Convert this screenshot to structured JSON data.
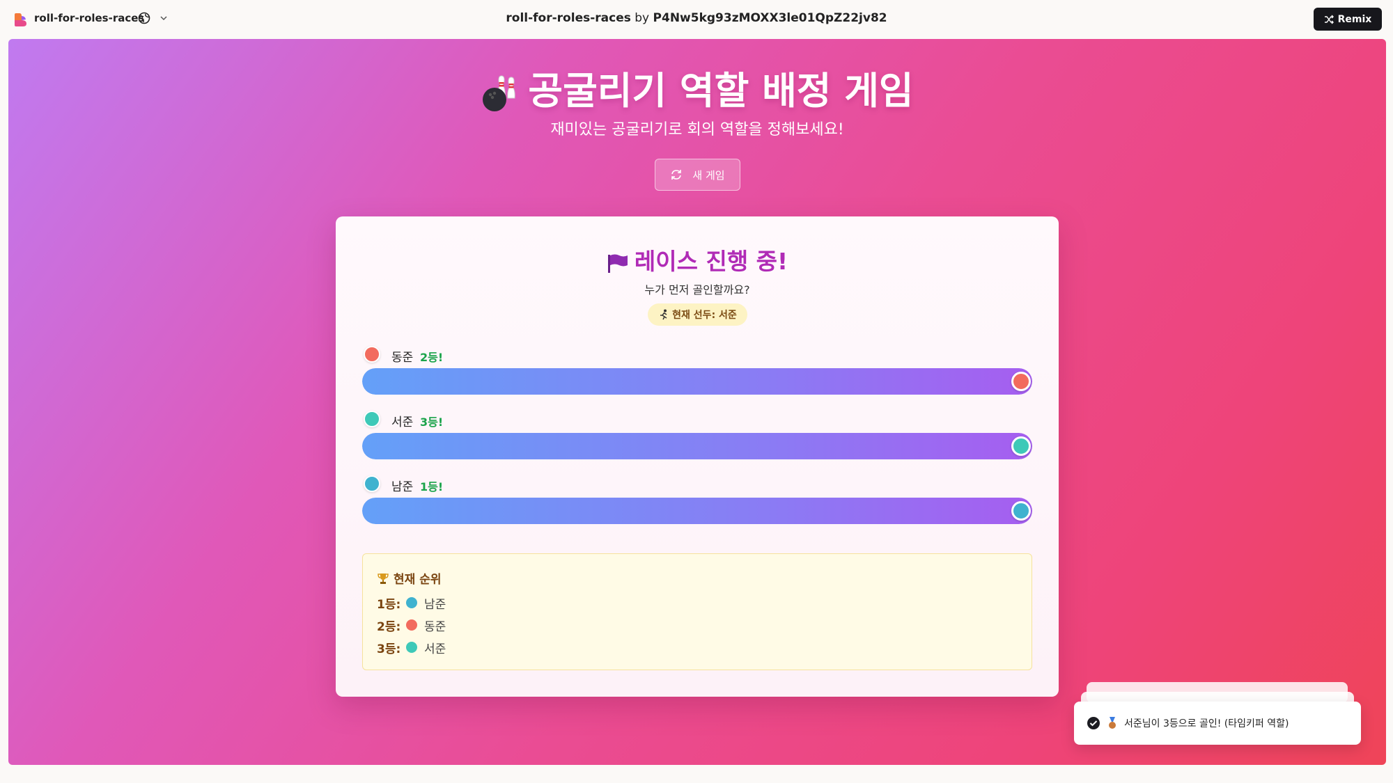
{
  "topbar": {
    "app_name": "roll-for-roles-races",
    "title_app": "roll-for-roles-races",
    "title_by": "by",
    "title_user": "P4Nw5kg93zMOXX3le01QpZ22jv82",
    "remix_label": "Remix"
  },
  "header": {
    "title": "공굴리기 역할 배정 게임",
    "subtitle": "재미있는 공굴리기로 회의 역할을 정해보세요!",
    "new_game_label": "새 게임"
  },
  "race": {
    "title": "레이스 진행 중!",
    "subtitle": "누가 먼저 골인할까요?",
    "leader_label": "현재 선두: 서준",
    "racers": [
      {
        "name": "동준",
        "rank": "2등!",
        "color": "#f26b5e",
        "progress": 1.0
      },
      {
        "name": "서준",
        "rank": "3등!",
        "color": "#3ec9b8",
        "progress": 1.0
      },
      {
        "name": "남준",
        "rank": "1등!",
        "color": "#3fb2cf",
        "progress": 1.0
      }
    ]
  },
  "ranking": {
    "title": "현재 순위",
    "rows": [
      {
        "label": "1등:",
        "name": "남준",
        "color": "#3fb2cf"
      },
      {
        "label": "2등:",
        "name": "동준",
        "color": "#f26b5e"
      },
      {
        "label": "3등:",
        "name": "서준",
        "color": "#3ec9b8"
      }
    ]
  },
  "toast": {
    "message": "서준님이 3등으로 골인! (타임키퍼 역할)"
  },
  "colors": {
    "accent": "#b02bb6",
    "rank_green": "#1aa34a",
    "track_start": "#64a0f8",
    "track_end": "#a65ef0"
  },
  "icons": [
    "app-logo-icon",
    "globe-icon",
    "chevron-down-icon",
    "shuffle-icon",
    "bowling-icon",
    "refresh-icon",
    "flag-icon",
    "runner-icon",
    "trophy-icon",
    "check-circle-icon",
    "medal-icon"
  ]
}
